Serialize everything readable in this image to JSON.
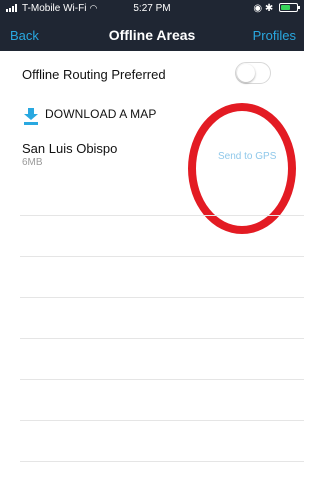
{
  "status_bar": {
    "carrier": "T-Mobile Wi-Fi",
    "time": "5:27 PM"
  },
  "nav": {
    "back_label": "Back",
    "title": "Offline Areas",
    "profiles_label": "Profiles"
  },
  "settings": {
    "offline_routing_label": "Offline Routing Preferred",
    "offline_routing_enabled": false
  },
  "download": {
    "label": "DOWNLOAD A MAP"
  },
  "maps": [
    {
      "name": "San Luis Obispo",
      "size": "6MB",
      "action_label": "Send to GPS"
    }
  ],
  "colors": {
    "header_bg": "#1f2633",
    "accent": "#29a8e0",
    "highlight_circle": "#e31b23",
    "battery_fill": "#37d45a"
  },
  "icons": {
    "download": "download-arrow-icon",
    "wifi": "wifi-icon",
    "battery": "battery-icon",
    "bluetooth": "bluetooth-icon",
    "location": "location-icon"
  }
}
